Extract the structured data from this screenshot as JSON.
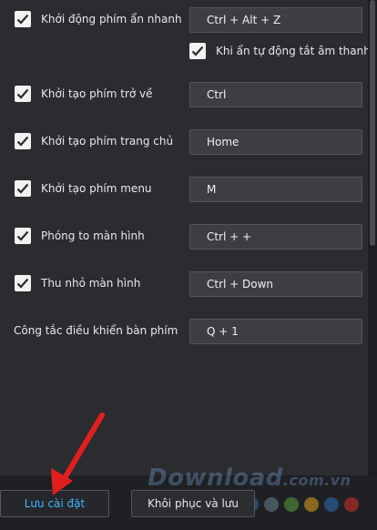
{
  "settings": {
    "rows": [
      {
        "label": "Khởi động phím ẩn nhanh",
        "value": "Ctrl + Alt + Z",
        "checked": true
      },
      {
        "label": "Khởi tạo phím trở về",
        "value": "Ctrl",
        "checked": true
      },
      {
        "label": "Khởi tạo phím trang chủ",
        "value": "Home",
        "checked": true
      },
      {
        "label": "Khởi tạo phím menu",
        "value": "M",
        "checked": true
      },
      {
        "label": "Phóng to màn hình",
        "value": "Ctrl + +",
        "checked": true
      },
      {
        "label": "Thu nhỏ màn hình",
        "value": "Ctrl + Down",
        "checked": true
      },
      {
        "label": "Công tắc điều khiển bàn phím",
        "value": "Q + 1"
      }
    ],
    "mute_option": {
      "label": "Khi ẩn tự động tắt âm thanh",
      "checked": true
    }
  },
  "footer": {
    "save_label": "Lưu cài đặt",
    "restore_label": "Khôi phục và lưu"
  },
  "watermark": {
    "text": "Download",
    "suffix": ".com.vn",
    "dot_colors": [
      "#2d6fb6",
      "#6d7f8c",
      "#5aa33c",
      "#e0a51e",
      "#2d6fb6",
      "#d9322b"
    ]
  },
  "colors": {
    "background": "#2b2c30",
    "field": "#3d3e43",
    "accent": "#3fb6ff",
    "arrow": "#e01f1f"
  }
}
